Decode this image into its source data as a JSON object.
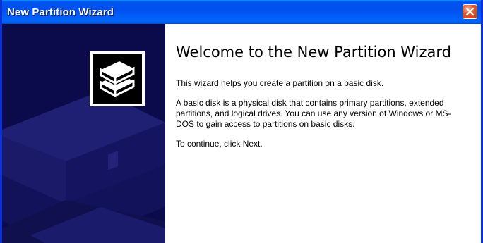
{
  "window": {
    "title": "New Partition Wizard",
    "accent": "#0053ee",
    "panel_color": "#0a0a4a"
  },
  "titlebar": {
    "close_icon": "close-icon"
  },
  "sidebar": {
    "logo_icon": "disks-icon"
  },
  "main": {
    "heading": "Welcome to the New Partition Wizard",
    "paragraphs": [
      "This wizard helps you create a partition on a basic disk.",
      "A basic disk is a physical disk that contains primary partitions, extended partitions, and logical drives. You can use any version of Windows or MS-DOS to gain access to partitions on basic disks.",
      "To continue, click Next."
    ]
  }
}
